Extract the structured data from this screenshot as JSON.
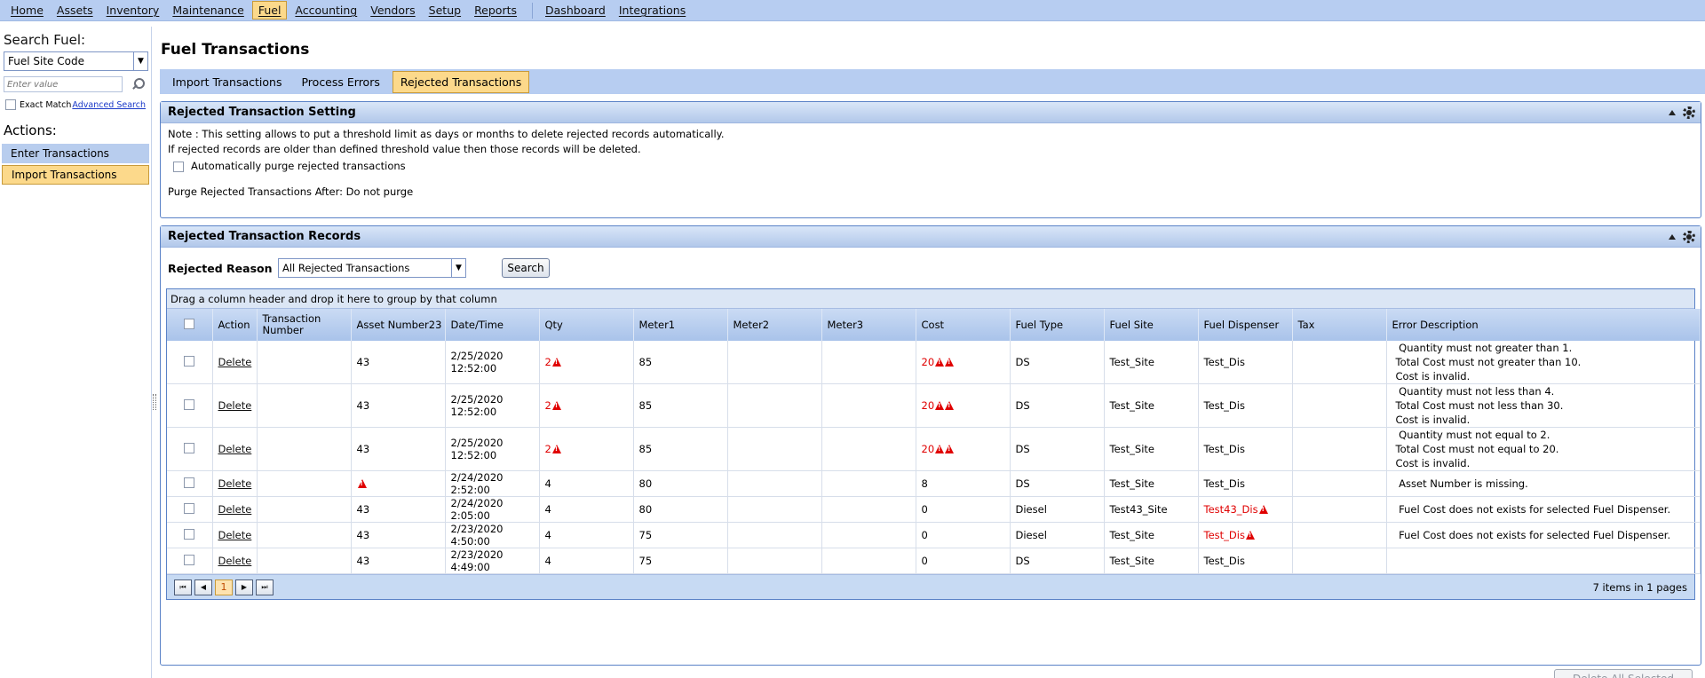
{
  "menu": [
    "Home",
    "Assets",
    "Inventory",
    "Maintenance",
    "Fuel",
    "Accounting",
    "Vendors",
    "Setup",
    "Reports",
    "Dashboard",
    "Integrations"
  ],
  "sidebar": {
    "search_title": "Search Fuel:",
    "search_field": "Fuel Site Code",
    "search_placeholder": "Enter value",
    "exact_match": "Exact Match",
    "advanced_search": "Advanced Search",
    "actions_title": "Actions:",
    "actions": [
      "Enter Transactions",
      "Import Transactions"
    ]
  },
  "page": {
    "title": "Fuel Transactions",
    "tabs": [
      "Import Transactions",
      "Process Errors",
      "Rejected Transactions"
    ]
  },
  "setting_panel": {
    "title": "Rejected Transaction Setting",
    "note_line1": "Note : This setting allows to put a threshold limit as days or months to delete rejected records automatically.",
    "note_line2": "If rejected records are older than defined threshold value then those records will be deleted.",
    "auto_purge_label": "Automatically purge rejected transactions",
    "purge_after": "Purge Rejected Transactions After: Do not purge"
  },
  "records_panel": {
    "title": "Rejected Transaction Records",
    "filter_label": "Rejected Reason",
    "filter_value": "All Rejected Transactions",
    "search_button": "Search",
    "group_hint": "Drag a column header and drop it here to group by that column",
    "columns": [
      "Action",
      "Transaction Number",
      "Asset Number23",
      "Date/Time",
      "Qty",
      "Meter1",
      "Meter2",
      "Meter3",
      "Cost",
      "Fuel Type",
      "Fuel Site",
      "Fuel Dispenser",
      "Tax",
      "Error Description"
    ],
    "delete_label": "Delete",
    "rows": [
      {
        "asset": "43",
        "datetime": "2/25/2020 12:52:00",
        "qty": "2",
        "meter1": "85",
        "cost": "20",
        "fuel_type": "DS",
        "fuel_site": "Test_Site",
        "dispenser": "Test_Dis",
        "errors": [
          " Quantity must not greater than 1.",
          "Total Cost must not greater than 10.",
          "Cost is invalid."
        ]
      },
      {
        "asset": "43",
        "datetime": "2/25/2020 12:52:00",
        "qty": "2",
        "meter1": "85",
        "cost": "20",
        "fuel_type": "DS",
        "fuel_site": "Test_Site",
        "dispenser": "Test_Dis",
        "errors": [
          " Quantity must not less than 4.",
          "Total Cost must not less than 30.",
          "Cost is invalid."
        ]
      },
      {
        "asset": "43",
        "datetime": "2/25/2020 12:52:00",
        "qty": "2",
        "meter1": "85",
        "cost": "20",
        "fuel_type": "DS",
        "fuel_site": "Test_Site",
        "dispenser": "Test_Dis",
        "errors": [
          " Quantity must not equal to 2.",
          "Total Cost must not equal to 20.",
          "Cost is invalid."
        ]
      },
      {
        "asset": "",
        "datetime": "2/24/2020 2:52:00",
        "qty": "4",
        "meter1": "80",
        "cost": "8",
        "fuel_type": "DS",
        "fuel_site": "Test_Site",
        "dispenser": "Test_Dis",
        "errors": [
          " Asset Number is missing."
        ]
      },
      {
        "asset": "43",
        "datetime": "2/24/2020 2:05:00",
        "qty": "4",
        "meter1": "80",
        "cost": "0",
        "fuel_type": "Diesel",
        "fuel_site": "Test43_Site",
        "dispenser": "Test43_Dis",
        "errors": [
          " Fuel Cost does not exists for selected Fuel Dispenser."
        ]
      },
      {
        "asset": "43",
        "datetime": "2/23/2020 4:50:00",
        "qty": "4",
        "meter1": "75",
        "cost": "0",
        "fuel_type": "Diesel",
        "fuel_site": "Test_Site",
        "dispenser": "Test_Dis",
        "errors": [
          " Fuel Cost does not exists for selected Fuel Dispenser."
        ]
      },
      {
        "asset": "43",
        "datetime": "2/23/2020 4:49:00",
        "qty": "4",
        "meter1": "75",
        "cost": "0",
        "fuel_type": "DS",
        "fuel_site": "Test_Site",
        "dispenser": "Test_Dis",
        "errors": []
      }
    ],
    "pager_current": "1",
    "pager_info": "7 items in 1 pages",
    "delete_all": "Delete All Selected"
  },
  "colors": {
    "menubar": "#b7cdf1",
    "active_tab": "#fcd98b",
    "error_red": "#e00000"
  }
}
